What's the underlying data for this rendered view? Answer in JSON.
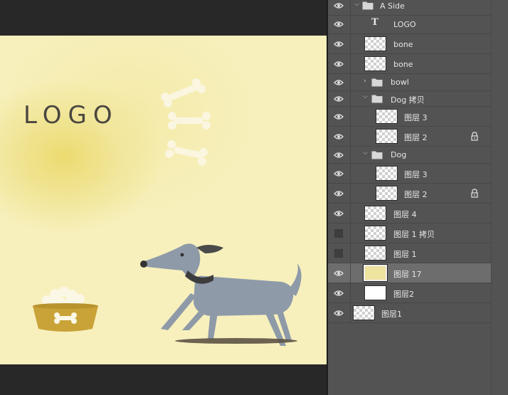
{
  "canvas": {
    "logo_text": "LOGO",
    "background_color": "#f7f0bd"
  },
  "layers": [
    {
      "name": "A Side",
      "kind": "group",
      "expanded": true,
      "visible": true,
      "locked": false
    },
    {
      "name": "LOGO",
      "kind": "text",
      "visible": true,
      "locked": false
    },
    {
      "name": "bone",
      "kind": "pixel",
      "visible": true,
      "locked": false
    },
    {
      "name": "bone",
      "kind": "pixel",
      "visible": true,
      "locked": false
    },
    {
      "name": "bowl",
      "kind": "group",
      "expanded": false,
      "visible": true,
      "locked": false
    },
    {
      "name": "Dog 拷贝",
      "kind": "group",
      "expanded": true,
      "visible": true,
      "locked": false
    },
    {
      "name": "图层 3",
      "kind": "pixel",
      "visible": true,
      "locked": false
    },
    {
      "name": "图层 2",
      "kind": "pixel",
      "visible": true,
      "locked": true
    },
    {
      "name": "Dog",
      "kind": "group",
      "expanded": true,
      "visible": true,
      "locked": false
    },
    {
      "name": "图层 3",
      "kind": "pixel",
      "visible": true,
      "locked": false
    },
    {
      "name": "图层 2",
      "kind": "pixel",
      "visible": true,
      "locked": true
    },
    {
      "name": "图层 4",
      "kind": "pixel",
      "visible": true,
      "locked": false
    },
    {
      "name": "图层 1 拷贝",
      "kind": "pixel",
      "visible": false,
      "locked": false
    },
    {
      "name": "图层 1",
      "kind": "pixel",
      "visible": false,
      "locked": false
    },
    {
      "name": "图层 17",
      "kind": "pixel",
      "visible": true,
      "locked": false,
      "selected": true
    },
    {
      "name": "图层2",
      "kind": "pixel",
      "visible": true,
      "locked": false
    },
    {
      "name": "图层1",
      "kind": "pixel",
      "visible": true,
      "locked": false
    }
  ]
}
